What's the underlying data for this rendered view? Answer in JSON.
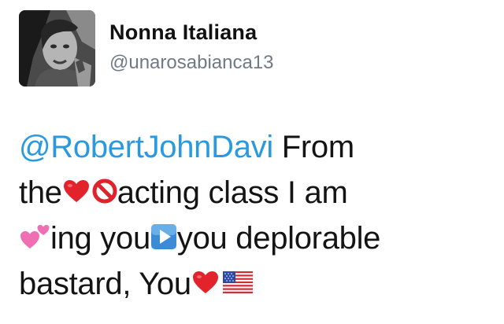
{
  "tweet": {
    "author": {
      "display_name": "Nonna Italiana",
      "handle": "@unarosabianca13",
      "avatar_icon": "profile-photo"
    },
    "colors": {
      "mention": "#2a9ae0",
      "handle": "#6f7a84",
      "text": "#141414"
    },
    "text": {
      "mention": "@RobertJohnDavi",
      "line1_rest": " From",
      "line2_a": "the",
      "line2_b": "acting class I am",
      "line3_a": "ing you",
      "line3_b": "you deplorable",
      "line4_a": "bastard, You"
    },
    "emojis": {
      "heart": "red-heart-emoji",
      "no_entry": "prohibited-emoji",
      "two_hearts": "two-hearts-emoji",
      "play": "play-button-emoji",
      "flag": "us-flag-emoji"
    }
  }
}
